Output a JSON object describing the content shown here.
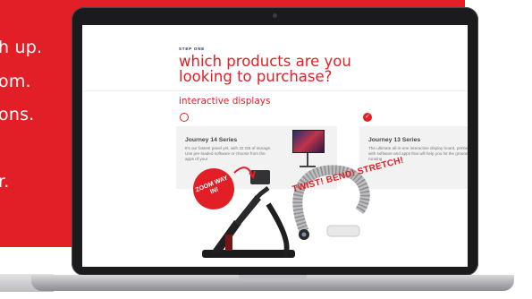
{
  "promo": {
    "lines": [
      "h up.",
      "om.",
      "ons.",
      "r."
    ]
  },
  "screen": {
    "eyebrow": "STEP ONE",
    "headline": "which products are you looking to purchase?",
    "section_title": "interactive displays",
    "cards": [
      {
        "title": "Journey 14 Series",
        "description": "It's our fastest panel yet, with 32 GB of storage. Use pre-loaded software or choose from the apps of your",
        "selected": false
      },
      {
        "title": "Journey 13 Series",
        "description": "The ultimate all-in-one interactive display board, preloaded with software and apps that will help you hit the ground running",
        "selected": true
      }
    ],
    "checkmark": "✓"
  },
  "overlay": {
    "zoom_badge": "ZOOM WAY IN!",
    "twist_text": "TWIST! BEND! STRETCH!"
  },
  "colors": {
    "brand_red": "#e21f26",
    "navy": "#1b2a78"
  }
}
